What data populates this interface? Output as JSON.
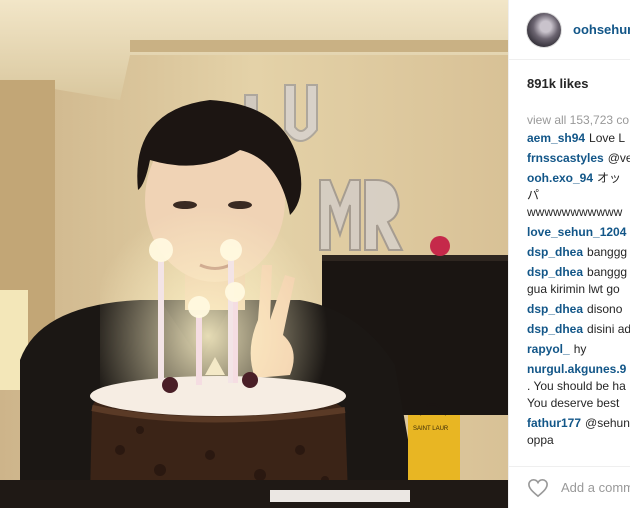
{
  "post": {
    "username": "oohsehun",
    "likes": "891k likes",
    "view_all": "view all 153,723 co"
  },
  "photo": {
    "balloon_letters": [
      "U",
      "MR"
    ],
    "bag_label": "SAINT LAUR"
  },
  "comments": [
    {
      "user": "aem_sh94",
      "lines": [
        "Love L"
      ]
    },
    {
      "user": "frnsscastyles",
      "lines": [
        "@ver"
      ]
    },
    {
      "user": "ooh.exo_94",
      "lines": [
        "オッパ",
        "wwwwwwwwwww"
      ]
    },
    {
      "user": "love_sehun_1204",
      "lines": [
        ""
      ]
    },
    {
      "user": "dsp_dhea",
      "lines": [
        "banggg"
      ]
    },
    {
      "user": "dsp_dhea",
      "lines": [
        "banggg",
        "gua kirimin lwt go"
      ]
    },
    {
      "user": "dsp_dhea",
      "lines": [
        "disono"
      ]
    },
    {
      "user": "dsp_dhea",
      "lines": [
        "disini ad"
      ]
    },
    {
      "user": "rapyol_",
      "lines": [
        "hy"
      ]
    },
    {
      "user": "nurgul.akgunes.9",
      "lines": [
        "",
        ". You should be ha",
        "You deserve best"
      ]
    },
    {
      "user": "fathur177",
      "lines": [
        "@sehuni",
        "oppa"
      ]
    }
  ],
  "add_comment_placeholder": "Add a comm",
  "icons": [
    "heart-icon"
  ]
}
